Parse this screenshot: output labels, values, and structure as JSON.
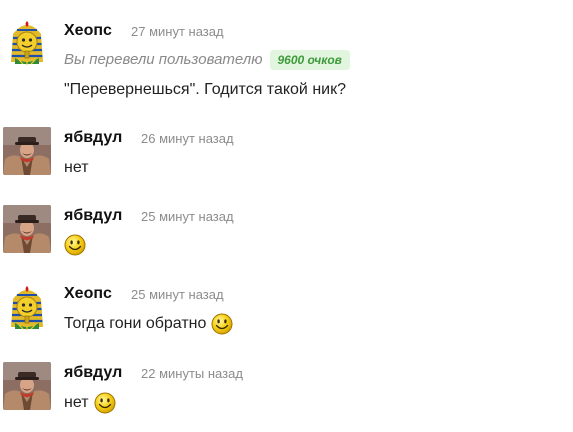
{
  "messages": [
    {
      "author": "Хеопс",
      "avatar_icon": "pharaoh-avatar-icon",
      "time": "27 минут назад",
      "system_text": "Вы перевели пользователю",
      "points_badge": "9600 очков",
      "text": "\"Перевернешься\". Годится такой ник?"
    },
    {
      "author": "ябвдул",
      "avatar_icon": "man-in-hat-avatar-icon",
      "time": "26 минут назад",
      "text": "нет"
    },
    {
      "author": "ябвдул",
      "avatar_icon": "man-in-hat-avatar-icon",
      "time": "25 минут назад",
      "text": "",
      "emoji": "smiley-icon"
    },
    {
      "author": "Хеопс",
      "avatar_icon": "pharaoh-avatar-icon",
      "time": "25 минут назад",
      "text": "Тогда гони обратно",
      "emoji": "smiley-icon"
    },
    {
      "author": "ябвдул",
      "avatar_icon": "man-in-hat-avatar-icon",
      "time": "22 минуты назад",
      "text": "нет",
      "emoji": "smiley-icon"
    }
  ],
  "colors": {
    "badge_bg": "#e2f5df",
    "badge_text": "#3d9b3a",
    "time_text": "#8c8c8c",
    "smiley_yellow": "#f7d21a"
  }
}
